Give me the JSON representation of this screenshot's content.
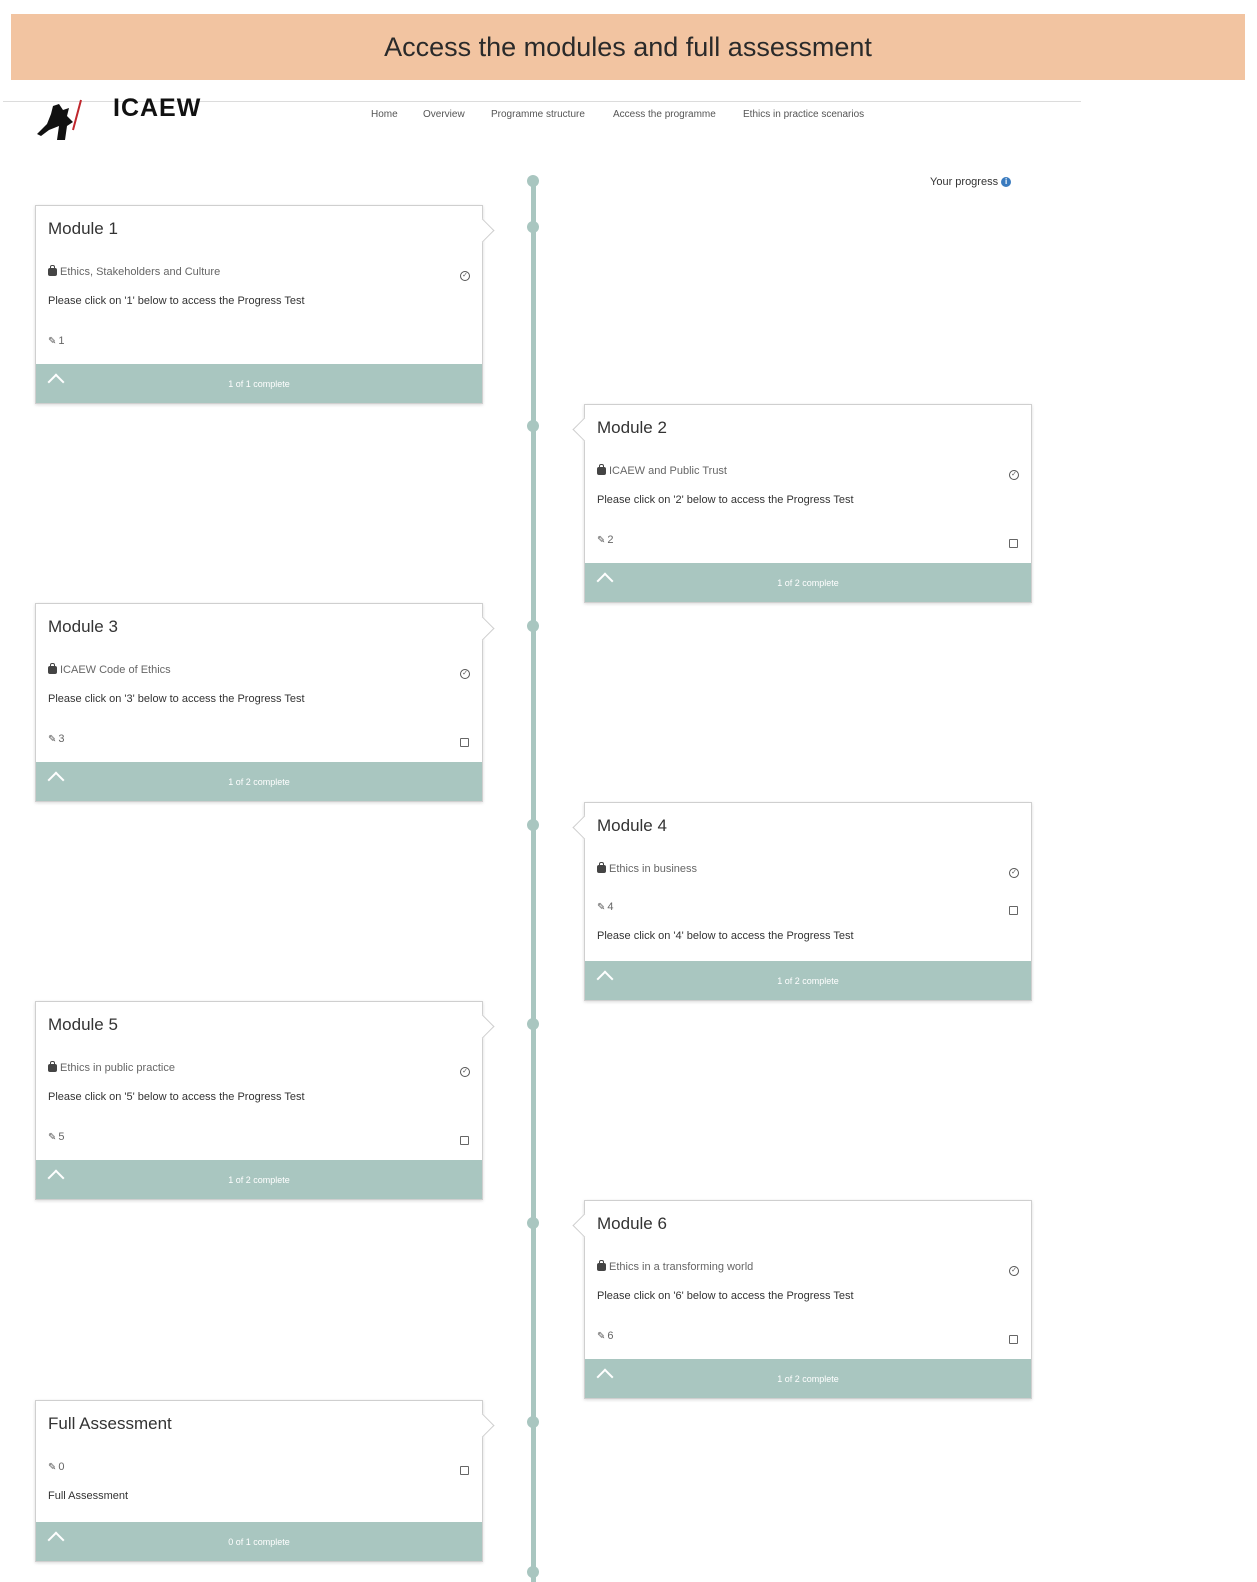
{
  "banner": {
    "title": "Access the modules and full assessment"
  },
  "header": {
    "logo_text": "ICAEW",
    "nav": [
      "Home",
      "Overview",
      "Programme structure",
      "Access the programme",
      "Ethics in practice scenarios"
    ]
  },
  "progress": {
    "label": "Your progress",
    "info_icon": "info-icon"
  },
  "colors": {
    "accent": "#a9c6c0",
    "banner": "#f2c4a1"
  },
  "modules": [
    {
      "title": "Module 1",
      "subtitle": "Ethics, Stakeholders and Culture",
      "instruction": "Please click on '1' below to access the Progress Test",
      "task": "1",
      "status": "1 of 1 complete"
    },
    {
      "title": "Module 2",
      "subtitle": "ICAEW and Public Trust",
      "instruction": "Please click on '2' below to access the Progress Test",
      "task": "2",
      "status": "1 of 2 complete"
    },
    {
      "title": "Module 3",
      "subtitle": "ICAEW Code of Ethics",
      "instruction": "Please click on '3' below to access the Progress Test",
      "task": "3",
      "status": "1 of 2 complete"
    },
    {
      "title": "Module 4",
      "subtitle": "Ethics in business",
      "instruction": "Please click on '4' below to access the Progress Test",
      "task": "4",
      "status": "1 of 2 complete"
    },
    {
      "title": "Module 5",
      "subtitle": "Ethics in public practice",
      "instruction": "Please click on '5' below to access the Progress Test",
      "task": "5",
      "status": "1 of 2 complete"
    },
    {
      "title": "Module 6",
      "subtitle": "Ethics in a transforming world",
      "instruction": "Please click on '6' below to access the Progress Test",
      "task": "6",
      "status": "1 of 2 complete"
    }
  ],
  "full_assessment": {
    "title": "Full Assessment",
    "task": "0",
    "label": "Full Assessment",
    "status": "0 of 1 complete"
  }
}
